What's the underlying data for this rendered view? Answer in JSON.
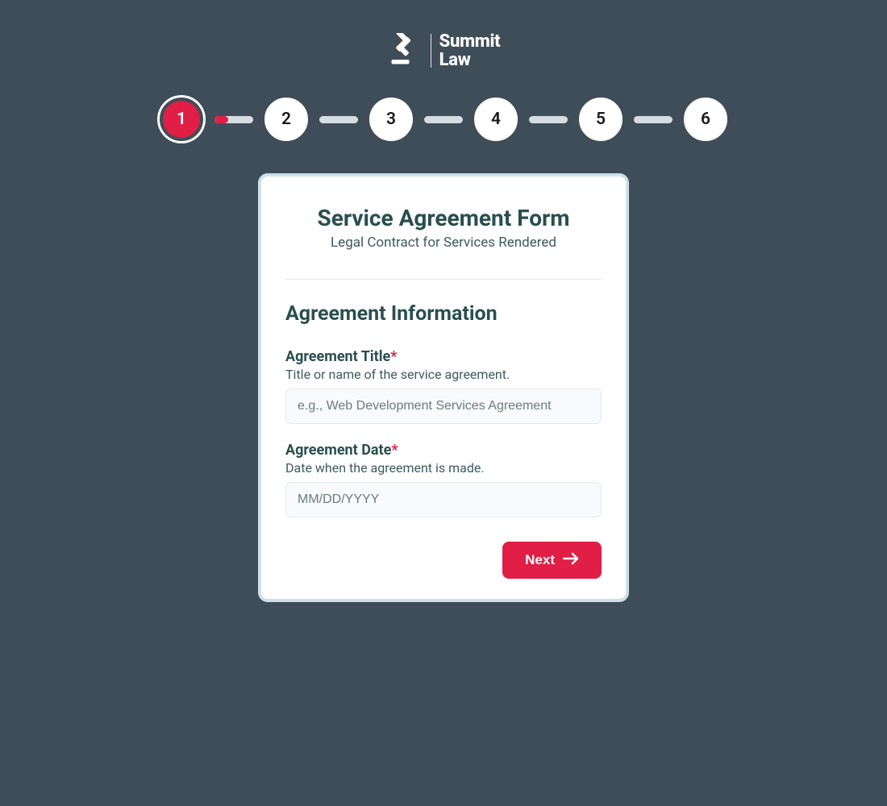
{
  "brand": {
    "name_line1": "Summit",
    "name_line2": "Law"
  },
  "stepper": {
    "steps": [
      "1",
      "2",
      "3",
      "4",
      "5",
      "6"
    ],
    "active_index": 0,
    "first_connector_fill_pct": 35
  },
  "card": {
    "title": "Service Agreement Form",
    "subtitle": "Legal Contract for Services Rendered",
    "section_title": "Agreement Information",
    "fields": {
      "agreement_title": {
        "label": "Agreement Title",
        "hint": "Title or name of the service agreement.",
        "placeholder": "e.g., Web Development Services Agreement",
        "required": true
      },
      "agreement_date": {
        "label": "Agreement Date",
        "hint": "Date when the agreement is made.",
        "placeholder": "MM/DD/YYYY",
        "required": true
      }
    },
    "next_label": "Next"
  },
  "colors": {
    "accent": "#e01e46",
    "background": "#3f4d58",
    "heading": "#2a4e4f"
  }
}
